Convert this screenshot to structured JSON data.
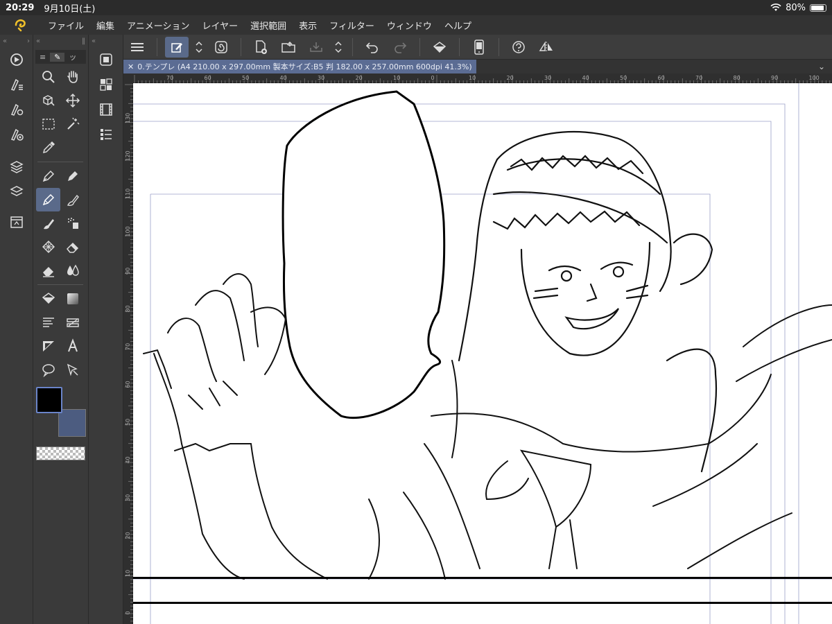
{
  "status": {
    "time": "20:29",
    "date": "9月10日(土)",
    "battery": "80%"
  },
  "menu": [
    "ファイル",
    "編集",
    "アニメーション",
    "レイヤー",
    "選択範囲",
    "表示",
    "フィルター",
    "ウィンドウ",
    "ヘルプ"
  ],
  "panel": {
    "tab_menu": "≡",
    "tab_pen": "✎",
    "tab_other": "ッ"
  },
  "document": {
    "tab_label": "0.テンプレ (A4 210.00 x 297.00mm 製本サイズ:B5 判 182.00 x 257.00mm 600dpi 41.3%)"
  },
  "ruler_top": [
    "70",
    "60",
    "50",
    "40",
    "30",
    "20",
    "10",
    "0",
    "10",
    "20",
    "30",
    "40",
    "50",
    "60",
    "70",
    "80",
    "90",
    "100"
  ],
  "ruler_left": [
    "130",
    "120",
    "110",
    "100",
    "90",
    "80",
    "70",
    "60",
    "50",
    "40",
    "30",
    "20",
    "10",
    "0"
  ],
  "colors": {
    "main": "#000000",
    "sub": "#4c5c80",
    "accent": "#5a6a8a",
    "tab": "#5b6c93"
  }
}
